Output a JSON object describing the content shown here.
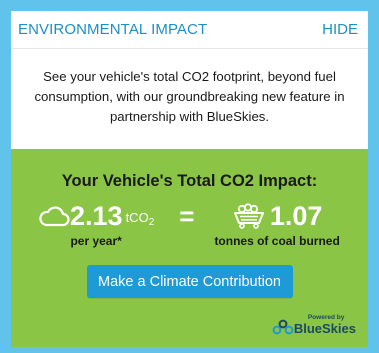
{
  "header": {
    "title": "ENVIRONMENTAL IMPACT",
    "hide_label": "HIDE"
  },
  "description": "See your vehicle's total CO2 footprint, beyond fuel consumption, with our groundbreaking new feature in partnership with BlueSkies.",
  "impact": {
    "title": "Your Vehicle's Total CO2 Impact:",
    "co2_value": "2.13",
    "co2_unit": "tCO",
    "co2_unit_sub": "2",
    "co2_caption": "per year*",
    "equals": "=",
    "coal_value": "1.07",
    "coal_caption": "tonnes of coal burned",
    "cloud_icon": "cloud-icon",
    "coal_icon": "coal-cart-icon"
  },
  "cta": {
    "label": "Make a Climate Contribution"
  },
  "brand": {
    "powered_by": "Powered by",
    "name": "BlueSkies",
    "logo_icon": "blueskies-logo-icon"
  },
  "colors": {
    "frame": "#5fc3ec",
    "accent": "#1d8fc3",
    "green_panel": "#8ac546",
    "button": "#1e9ad6",
    "brand_text": "#1b4a63"
  }
}
